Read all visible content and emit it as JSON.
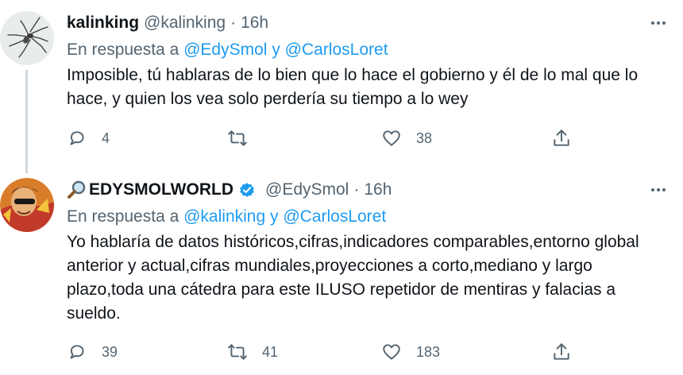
{
  "tweets": [
    {
      "display_name": "kalinking",
      "handle": "@kalinking",
      "separator": "·",
      "time": "16h",
      "reply_prefix": "En respuesta a",
      "reply_mention_1": "@EdySmol",
      "reply_conj": "y",
      "reply_mention_2": "@CarlosLoret",
      "text": "Imposible, tú hablaras de lo bien que lo hace el gobierno y él de lo mal que lo hace, y quien los vea solo perdería su tiempo a lo wey",
      "replies": "4",
      "retweets": "",
      "likes": "38"
    },
    {
      "display_name": "EDYSMOLWORLD",
      "handle": "@EdySmol",
      "separator": "·",
      "time": "16h",
      "reply_prefix": "En respuesta a",
      "reply_mention_1": "@kalinking",
      "reply_conj": "y",
      "reply_mention_2": "@CarlosLoret",
      "text": "Yo hablaría de datos históricos,cifras,indicadores comparables,entorno global anterior y actual,cifras mundiales,proyecciones a corto,mediano y largo plazo,toda una cátedra para este ILUSO repetidor de mentiras y falacias a sueldo.",
      "replies": "39",
      "retweets": "41",
      "likes": "183"
    }
  ],
  "icons": {
    "more": "more-icon",
    "reply": "reply-icon",
    "retweet": "retweet-icon",
    "like": "heart-icon",
    "share": "share-icon",
    "verified": "verified-badge-icon",
    "magnifier": "magnifying-glass-icon"
  },
  "colors": {
    "link": "#1d9bf0",
    "secondary": "#536471",
    "primary_text": "#0f1419",
    "verified": "#1d9bf0"
  }
}
